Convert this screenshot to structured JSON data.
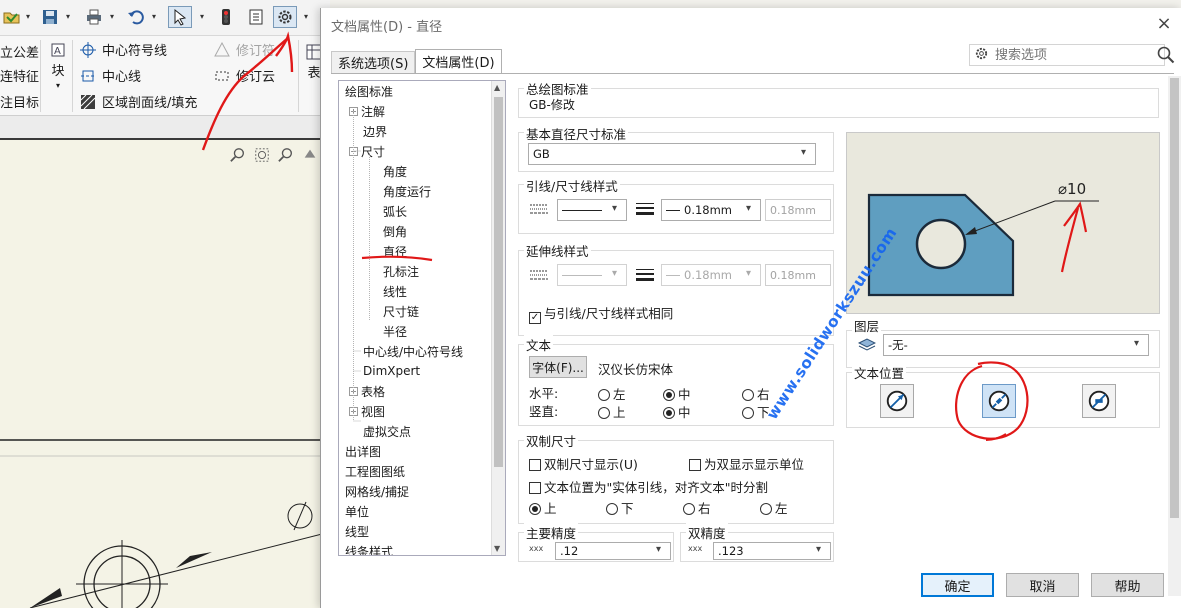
{
  "background": {
    "commands": {
      "tolerance": "立公差",
      "feature": "连特征",
      "datum_target": "注目标",
      "block": "块",
      "center_mark": "中心符号线",
      "centerline": "中心线",
      "hatch": "区域剖面线/填充",
      "revision_symbol": "修订符",
      "revision_cloud": "修订云",
      "table": "表"
    },
    "drawing_dim_symbol": "ϕ"
  },
  "dialog": {
    "title": "文档属性(D) - 直径",
    "close_symbol": "×",
    "tabs": [
      {
        "label": "系统选项(S)"
      },
      {
        "label": "文档属性(D)"
      }
    ],
    "search_placeholder": "搜索选项",
    "tree": [
      {
        "label": "绘图标准"
      },
      {
        "label": "注解"
      },
      {
        "label": "边界"
      },
      {
        "label": "尺寸"
      },
      {
        "label": "角度"
      },
      {
        "label": "角度运行"
      },
      {
        "label": "弧长"
      },
      {
        "label": "倒角"
      },
      {
        "label": "直径"
      },
      {
        "label": "孔标注"
      },
      {
        "label": "线性"
      },
      {
        "label": "尺寸链"
      },
      {
        "label": "半径"
      },
      {
        "label": "中心线/中心符号线"
      },
      {
        "label": "DimXpert"
      },
      {
        "label": "表格"
      },
      {
        "label": "视图"
      },
      {
        "label": "虚拟交点"
      },
      {
        "label": "出详图"
      },
      {
        "label": "工程图图纸"
      },
      {
        "label": "网格线/捕捉"
      },
      {
        "label": "单位"
      },
      {
        "label": "线型"
      },
      {
        "label": "线条样式"
      }
    ],
    "overall_standard": {
      "label": "总绘图标准",
      "value": "GB-修改"
    },
    "base_standard": {
      "label": "基本直径尺寸标准",
      "value": "GB"
    },
    "leader_style": {
      "label": "引线/尺寸线样式",
      "thickness": "0.18mm",
      "custom": "0.18mm"
    },
    "extension_style": {
      "label": "延伸线样式",
      "thickness": "0.18mm",
      "custom": "0.18mm",
      "same_label": "与引线/尺寸线样式相同"
    },
    "text": {
      "label": "文本",
      "font_button": "字体(F)...",
      "font_name": "汉仪长仿宋体",
      "horizontal_label": "水平:",
      "vertical_label": "竖直:",
      "h_left": "左",
      "h_center": "中",
      "h_right": "右",
      "v_up": "上",
      "v_center": "中",
      "v_down": "下"
    },
    "dual": {
      "label": "双制尺寸",
      "show_label": "双制尺寸显示(U)",
      "units_label": "为双显示显示单位",
      "position_label": "文本位置为\"实体引线，对齐文本\"时分割",
      "pos_up": "上",
      "pos_down": "下",
      "pos_right": "右",
      "pos_left": "左"
    },
    "precision": {
      "primary_label": "主要精度",
      "primary_value": ".12",
      "dual_label": "双精度",
      "dual_value": ".123"
    },
    "preview": {
      "dim_text": "⌀10"
    },
    "layer": {
      "label": "图层",
      "value": "-无-"
    },
    "text_position_label": "文本位置",
    "buttons": {
      "ok": "确定",
      "cancel": "取消",
      "help": "帮助"
    },
    "watermark": "www.solidworkszuu.com"
  }
}
